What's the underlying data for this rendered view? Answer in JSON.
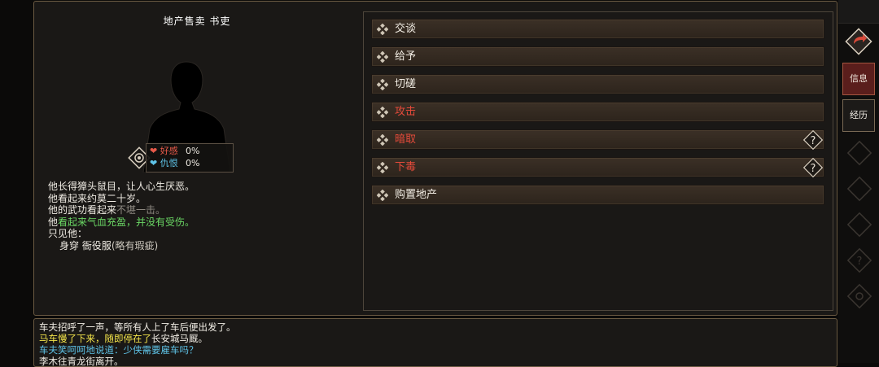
{
  "npc": {
    "title": "地产售卖 书吏",
    "favor_label": "好感",
    "favor_value": "0%",
    "hatred_label": "仇恨",
    "hatred_value": "0%"
  },
  "description": {
    "line1": "他长得獐头鼠目，让人心生厌恶。",
    "line2": "他看起来约莫二十岁。",
    "line3_prefix": "他的武功看起来",
    "line3_value": "不堪一击。",
    "line4_prefix": "他",
    "line4_value": "看起来气血充盈，并没有受伤。",
    "line5": "只见他：",
    "line6_prefix": "身穿  衙役服",
    "line6_suffix": "(略有瑕疵)"
  },
  "actions": [
    {
      "label": "交谈",
      "style": "normal"
    },
    {
      "label": "给予",
      "style": "normal"
    },
    {
      "label": "切磋",
      "style": "normal"
    },
    {
      "label": "攻击",
      "style": "red"
    },
    {
      "label": "暗取",
      "style": "red",
      "help": true
    },
    {
      "label": "下毒",
      "style": "red",
      "help": true
    },
    {
      "label": "购置地产",
      "style": "normal"
    }
  ],
  "log": {
    "line1": "车夫招呼了一声，等所有人上了车后便出发了。",
    "line2_yellow": "马车慢了下来，随即停在了",
    "line2_rest": "长安城马厩。",
    "line3": "车夫笑呵呵地说道：少侠需要雇车吗？",
    "line4": "李木往青龙街离开。"
  },
  "sidebar": {
    "info_label": "信息",
    "history_label": "经历"
  },
  "colors": {
    "accent_red": "#e54a3a",
    "favor": "#e85a4a",
    "hatred": "#5fc4e8",
    "good_status": "#6bd865",
    "log_yellow": "#f3e44a"
  }
}
